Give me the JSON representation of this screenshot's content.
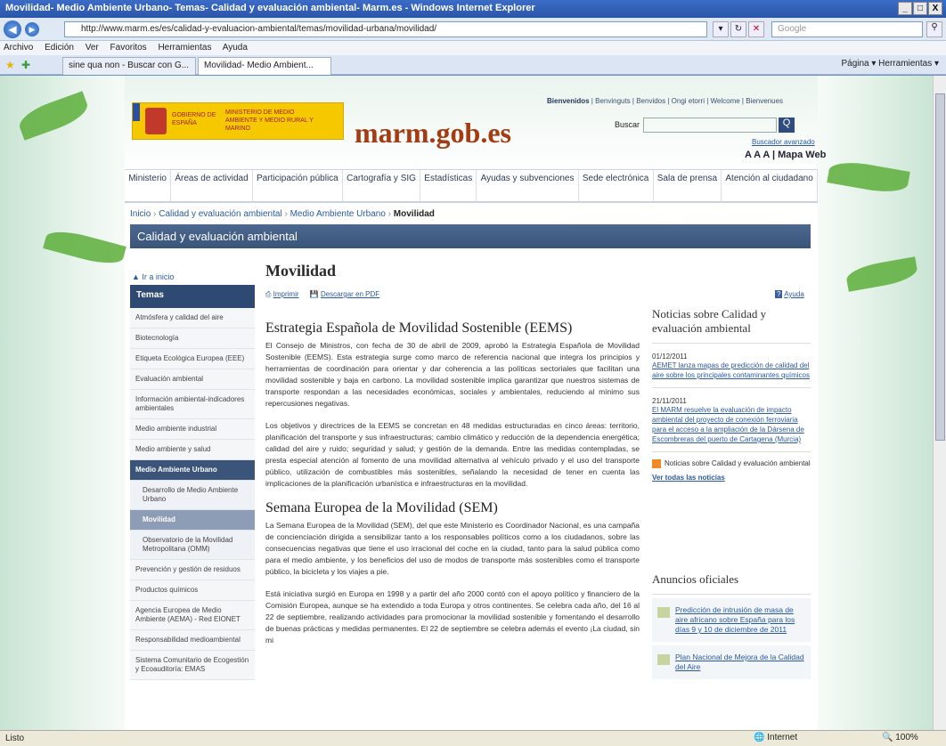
{
  "window": {
    "title": "Movilidad- Medio Ambiente Urbano- Temas- Calidad y evaluación ambiental- Marm.es - Windows Internet Explorer",
    "controls": [
      "_",
      "□",
      "X"
    ]
  },
  "browser": {
    "url": "http://www.marm.es/es/calidad-y-evaluacion-ambiental/temas/movilidad-urbana/movilidad/",
    "search_placeholder": "Google",
    "menu": [
      "Archivo",
      "Edición",
      "Ver",
      "Favoritos",
      "Herramientas",
      "Ayuda"
    ],
    "tabs": [
      {
        "label": "sine qua non - Buscar con G..."
      },
      {
        "label": "Movilidad- Medio Ambient..."
      }
    ],
    "command_bar": "Página ▾   Herramientas ▾",
    "status": {
      "left": "Listo",
      "zone": "Internet",
      "zoom": "100%"
    }
  },
  "header": {
    "gov_line1": "GOBIERNO DE ESPAÑA",
    "gov_line2": "MINISTERIO DE MEDIO AMBIENTE Y MEDIO RURAL Y MARINO",
    "site_name": "marm.gob.es",
    "welcome_bold": "Bienvenidos",
    "welcome_rest": " | Benvinguts | Benvidos | Ongi etorri | Welcome | Bienvenues",
    "search_label": "Buscar",
    "search_button": "Q",
    "advanced_search": "Buscador avanzado",
    "font_sizes": "A A A",
    "sitemap": "Mapa Web"
  },
  "nav": [
    "Ministerio",
    "Áreas de actividad",
    "Participación pública",
    "Cartografía y SIG",
    "Estadísticas",
    "Ayudas y subvenciones",
    "Sede electrónica",
    "Sala de prensa",
    "Atención al ciudadano"
  ],
  "breadcrumb": {
    "items": [
      "Inicio",
      "Calidad y evaluación ambiental",
      "Medio Ambiente Urbano"
    ],
    "current": "Movilidad",
    "sep": "›"
  },
  "section_title": "Calidad y evaluación ambiental",
  "sidebar": {
    "back": "Ir a inicio",
    "header": "Temas",
    "items": [
      {
        "label": "Atmósfera y calidad del aire",
        "type": "it"
      },
      {
        "label": "Biotecnología",
        "type": "it"
      },
      {
        "label": "Etiqueta Ecológica Europea (EEE)",
        "type": "it"
      },
      {
        "label": "Evaluación ambiental",
        "type": "it"
      },
      {
        "label": "Información ambiental-indicadores ambientales",
        "type": "it"
      },
      {
        "label": "Medio ambiente industrial",
        "type": "it"
      },
      {
        "label": "Medio ambiente y salud",
        "type": "it"
      },
      {
        "label": "Medio Ambiente Urbano",
        "type": "sel"
      },
      {
        "label": "Desarrollo de Medio Ambiente Urbano",
        "type": "sub"
      },
      {
        "label": "Movilidad",
        "type": "cur"
      },
      {
        "label": "Observatorio de la Movilidad Metropolitana (OMM)",
        "type": "sub"
      },
      {
        "label": "Prevención y gestión de residuos",
        "type": "it"
      },
      {
        "label": "Productos químicos",
        "type": "it"
      },
      {
        "label": "Agencia Europea de Medio Ambiente (AEMA) - Red EIONET",
        "type": "it"
      },
      {
        "label": "Responsabilidad medioambiental",
        "type": "it"
      },
      {
        "label": "Sistema Comunitario de Ecogestión y Ecoauditoría: EMAS",
        "type": "it"
      }
    ]
  },
  "main": {
    "title": "Movilidad",
    "print": "Imprimir",
    "pdf": "Descargar en PDF",
    "help": "Ayuda",
    "h1": "Estrategia Española de Movilidad Sostenible (EEMS)",
    "p1": "El Consejo de Ministros, con fecha de 30 de abril de 2009, aprobó la Estrategia Española de Movilidad Sostenible (EEMS). Esta estrategia surge como marco de referencia nacional que integra los principios y herramientas de coordinación para orientar y dar coherencia a las políticas sectoriales que facilitan una movilidad sostenible y baja en carbono. La movilidad sostenible implica garantizar que nuestros sistemas de transporte respondan a las necesidades económicas, sociales y ambientales, reduciendo al mínimo sus repercusiones negativas.",
    "p2": "Los objetivos y directrices de la EEMS se concretan en 48 medidas estructuradas en cinco áreas: territorio, planificación del transporte y sus infraestructuras; cambio climático y reducción de la dependencia energética; calidad del aire y ruido; seguridad y salud; y gestión de la demanda. Entre las medidas contempladas, se presta especial atención al fomento de una movilidad alternativa al vehículo privado y el uso del transporte público, utilización de combustibles más sostenibles, señalando la necesidad de tener en cuenta las implicaciones de la planificación urbanística e infraestructuras en la movilidad.",
    "h2": "Semana Europea de la Movilidad (SEM)",
    "p3": "La Semana Europea de la Movilidad (SEM), del que este Ministerio es Coordinador Nacional, es una campaña de concienciación dirigida a sensibilizar tanto a los responsables políticos como a los ciudadanos, sobre las consecuencias negativas que tiene el uso irracional del coche en la ciudad, tanto para la salud pública como para el medio ambiente, y los beneficios del uso de modos de transporte más sostenibles como el transporte público, la bicicleta y los viajes a pie.",
    "p4": "Está iniciativa surgió en Europa en 1998 y a partir del año 2000 contó con el apoyo político y financiero de la Comisión Europea, aunque se ha extendido a toda Europa y otros continentes. Se celebra cada año, del 16 al 22 de septiembre, realizando actividades para promocionar la movilidad sostenible y fomentando el desarrollo de buenas prácticas y medidas permanentes. El 22 de septiembre se celebra además el evento ¡La ciudad, sin mi"
  },
  "news": {
    "title": "Noticias sobre Calidad y evaluación ambiental",
    "items": [
      {
        "date": "01/12/2011",
        "text": "AEMET lanza mapas de predicción de calidad del aire sobre los principales contaminantes químicos"
      },
      {
        "date": "21/11/2011",
        "text": "El MARM resuelve la evaluación de impacto ambiental del proyecto de conexión ferroviaria para el acceso a la ampliación de la Dársena de Escombreras del puerto de Cartagena (Murcia)"
      }
    ],
    "rss": "Noticias sobre Calidad y evaluación ambiental",
    "all": "Ver todas las noticias"
  },
  "ads": {
    "title": "Anuncios oficiales",
    "items": [
      "Predicción de intrusión de masa de aire africano sobre España para los días 9 y 10 de diciembre de 2011",
      "Plan Nacional de Mejora de la Calidad del Aire"
    ]
  }
}
